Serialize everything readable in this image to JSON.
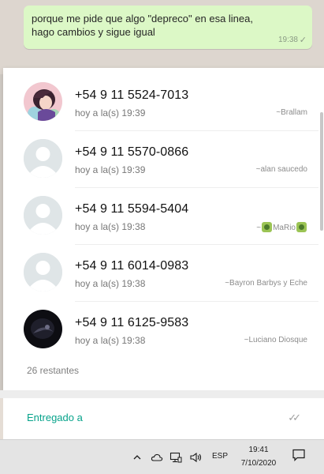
{
  "chat": {
    "message_text": "porque me pide que algo \"depreco\"  en esa linea,\nhago cambios y sigue igual",
    "message_time": "19:38",
    "message_status_icon": "single-check-icon"
  },
  "contacts_popup": {
    "rows": [
      {
        "phone": "+54 9 11 5524-7013",
        "time": "hoy a la(s) 19:39",
        "alias": "~Brallam",
        "avatar": "photo-girl"
      },
      {
        "phone": "+54 9 11 5570-0866",
        "time": "hoy a la(s) 19:39",
        "alias": "~alan saucedo",
        "avatar": "default"
      },
      {
        "phone": "+54 9 11 5594-5404",
        "time": "hoy a la(s) 19:38",
        "alias_prefix": "~",
        "alias_name": "MaRio",
        "avatar": "default"
      },
      {
        "phone": "+54 9 11 6014-0983",
        "time": "hoy a la(s) 19:38",
        "alias": "~Bayron Barbys y Eche",
        "avatar": "default"
      },
      {
        "phone": "+54 9 11 6125-9583",
        "time": "hoy a la(s) 19:38",
        "alias": "~Luciano Diosque",
        "avatar": "photo-dark"
      }
    ],
    "remaining": "26 restantes"
  },
  "delivered": {
    "label": "Entregado a",
    "icon": "double-check-icon"
  },
  "taskbar": {
    "language": "ESP",
    "time": "19:41",
    "date": "7/10/2020",
    "icons": [
      "chevron-up-icon",
      "cloud-icon",
      "network-icon",
      "volume-icon",
      "notification-icon"
    ]
  },
  "colors": {
    "bubble": "#dcf8c6",
    "accent_green": "#07a38b",
    "taskbar": "#e4e4e4"
  }
}
